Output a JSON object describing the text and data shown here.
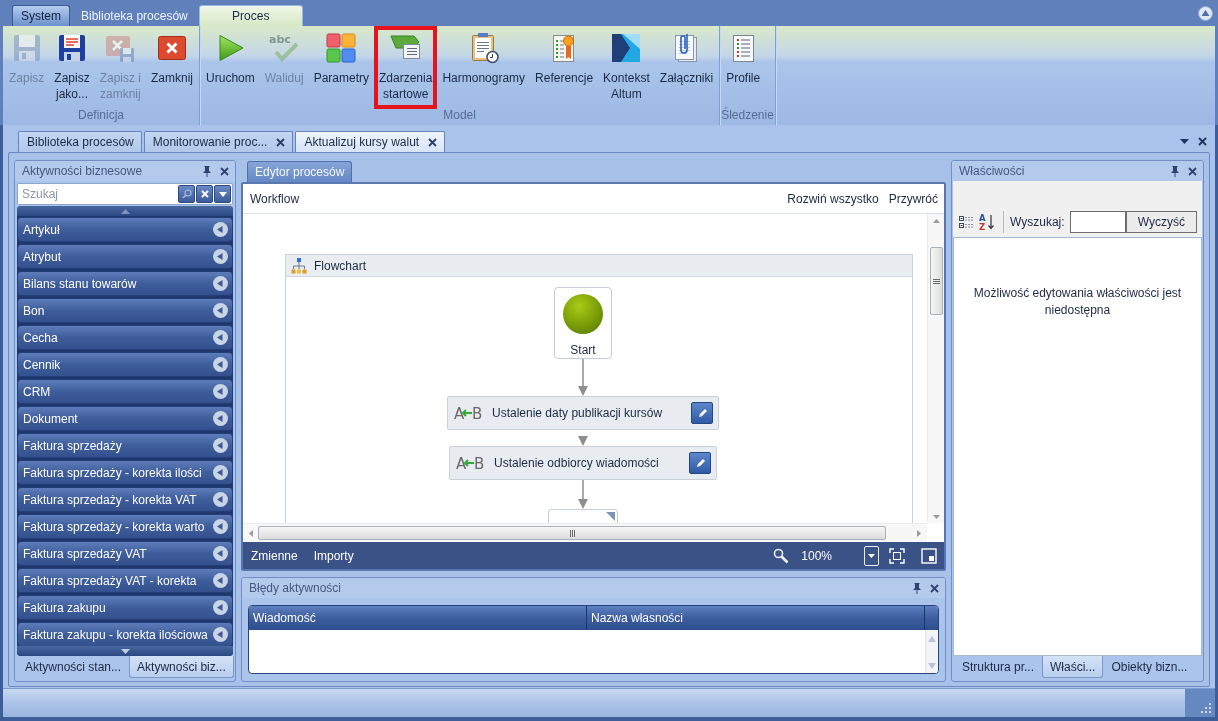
{
  "ribbon_tabs": [
    {
      "label": "System",
      "kind": "menu",
      "selected": false
    },
    {
      "label": "Biblioteka procesów",
      "kind": "tab",
      "selected": false
    },
    {
      "label": "Proces",
      "kind": "tab",
      "selected": true
    }
  ],
  "ribbon_groups": [
    {
      "label": "Definicja",
      "buttons": [
        {
          "label": "Zapisz",
          "disabled": true,
          "highlighted": false
        },
        {
          "label": "Zapisz\njako...",
          "disabled": false,
          "highlighted": false
        },
        {
          "label": "Zapisz i\nzamknij",
          "disabled": true,
          "highlighted": false
        },
        {
          "label": "Zamknij",
          "disabled": false,
          "highlighted": false
        }
      ]
    },
    {
      "label": "Model",
      "buttons": [
        {
          "label": "Uruchom",
          "disabled": false,
          "highlighted": false
        },
        {
          "label": "Waliduj",
          "disabled": true,
          "highlighted": false,
          "icon_text": "abc"
        },
        {
          "label": "Parametry",
          "disabled": false,
          "highlighted": false
        },
        {
          "label": "Zdarzenia\nstartowe",
          "disabled": false,
          "highlighted": true
        },
        {
          "label": "Harmonogramy",
          "disabled": false,
          "highlighted": false
        },
        {
          "label": "Referencje",
          "disabled": false,
          "highlighted": false
        },
        {
          "label": "Kontekst\nAltum",
          "disabled": false,
          "highlighted": false
        },
        {
          "label": "Załączniki",
          "disabled": false,
          "highlighted": false
        }
      ]
    },
    {
      "label": "Śledzenie",
      "buttons": [
        {
          "label": "Profile",
          "disabled": false,
          "highlighted": false
        }
      ]
    }
  ],
  "document_tabs": [
    {
      "label": "Biblioteka procesów",
      "closable": false,
      "selected": false
    },
    {
      "label": "Monitorowanie proc...",
      "closable": true,
      "selected": false
    },
    {
      "label": "Aktualizuj kursy walut",
      "closable": true,
      "selected": true
    }
  ],
  "activities_panel": {
    "title": "Aktywności biznesowe",
    "search": {
      "placeholder": "Szukaj"
    },
    "items": [
      "Artykuł",
      "Atrybut",
      "Bilans stanu towarów",
      "Bon",
      "Cecha",
      "Cennik",
      "CRM",
      "Dokument",
      "Faktura sprzedaży",
      "Faktura sprzedaży - korekta ilości",
      "Faktura sprzedaży - korekta VAT",
      "Faktura sprzedaży - korekta warto",
      "Faktura sprzedaży VAT",
      "Faktura sprzedaży VAT - korekta",
      "Faktura zakupu",
      "Faktura zakupu - korekta ilościowa"
    ],
    "bottom_tabs": [
      {
        "label": "Aktywności stan...",
        "selected": false
      },
      {
        "label": "Aktywności biz...",
        "selected": true
      }
    ]
  },
  "process_editor": {
    "tabs": [
      {
        "label": "Edytor procesów",
        "selected": true
      }
    ],
    "breadcrumb": "Workflow",
    "links": [
      "Rozwiń wszystko",
      "Przywróć"
    ],
    "flowchart": {
      "title": "Flowchart",
      "start": "Start",
      "activities": [
        {
          "label": "Ustalenie daty publikacji kursów",
          "icon_text": [
            "A",
            "B"
          ]
        },
        {
          "label": "Ustalenie odbiorcy wiadomości",
          "icon_text": [
            "A",
            "B"
          ]
        }
      ]
    },
    "footer_tabs": [
      "Zmienne",
      "Importy"
    ],
    "zoom": "100%"
  },
  "errors_panel": {
    "title": "Błędy aktywności",
    "columns": [
      "Wiadomość",
      "Nazwa własności"
    ]
  },
  "properties_panel": {
    "title": "Właściwości",
    "sort_icon_text": [
      "A",
      "Z"
    ],
    "search_label": "Wyszukaj:",
    "clear_button": "Wyczyść",
    "message": "Możliwość edytowania właściwości jest niedostępna",
    "bottom_tabs": [
      {
        "label": "Struktura pr...",
        "selected": false
      },
      {
        "label": "Właści...",
        "selected": true
      },
      {
        "label": "Obiekty bizn...",
        "selected": false
      }
    ]
  }
}
